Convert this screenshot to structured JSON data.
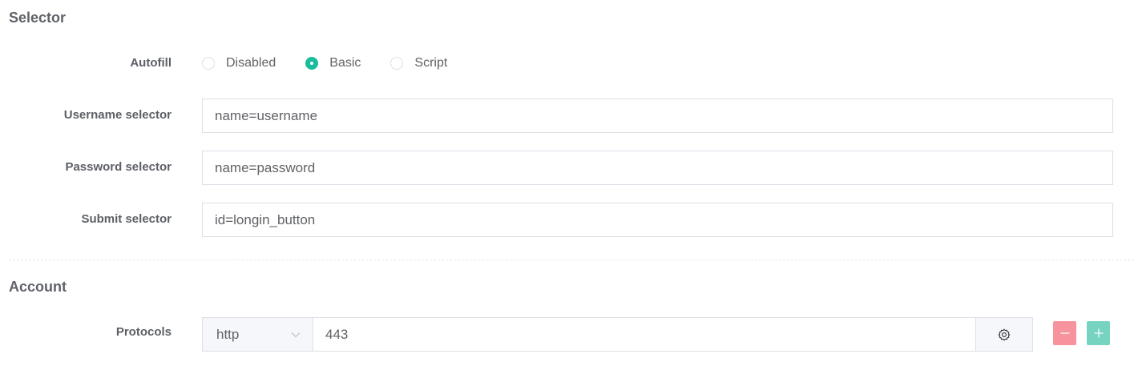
{
  "selector_section": {
    "title": "Selector",
    "autofill": {
      "label": "Autofill",
      "options": [
        "Disabled",
        "Basic",
        "Script"
      ],
      "selected": "Basic"
    },
    "username": {
      "label": "Username selector",
      "value": "name=username"
    },
    "password": {
      "label": "Password selector",
      "value": "name=password"
    },
    "submit": {
      "label": "Submit selector",
      "value": "id=longin_button"
    }
  },
  "account_section": {
    "title": "Account",
    "protocols": {
      "label": "Protocols",
      "protocol": "http",
      "port": "443"
    }
  },
  "colors": {
    "accent": "#1abc9c",
    "remove": "#f6939c",
    "add": "#76d3c0"
  },
  "icons": {
    "protocol_dropdown": "chevron-down-icon",
    "settings": "gear-icon",
    "remove": "minus-icon",
    "add": "plus-icon"
  }
}
